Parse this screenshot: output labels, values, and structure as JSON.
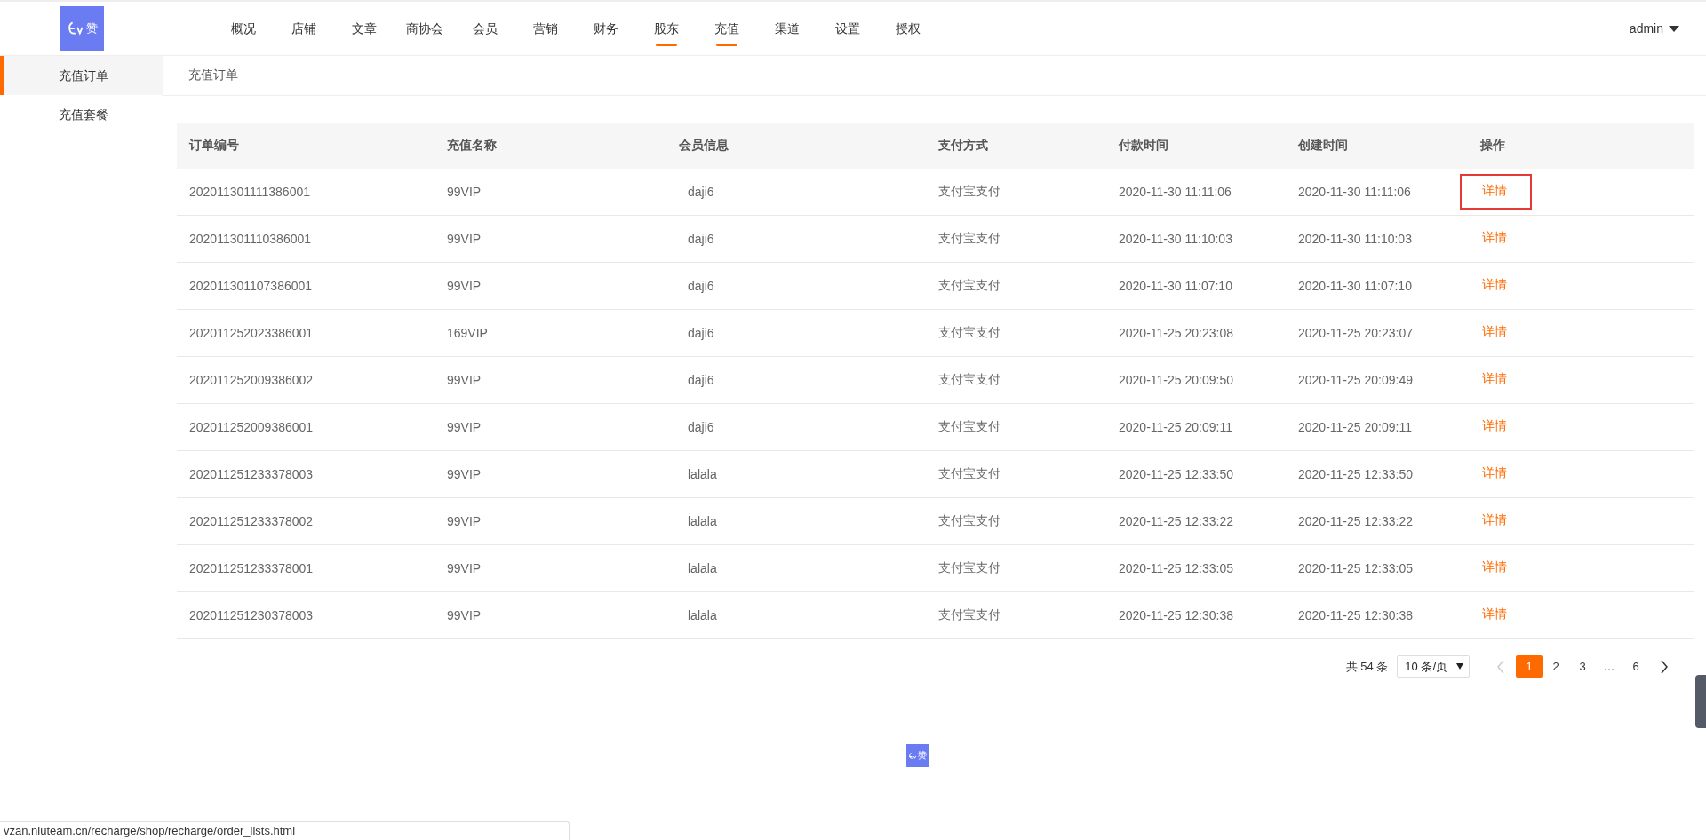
{
  "header": {
    "logo": {
      "text": "赞"
    },
    "nav": [
      {
        "label": "概况",
        "selected": false
      },
      {
        "label": "店铺",
        "selected": false
      },
      {
        "label": "文章",
        "selected": false
      },
      {
        "label": "商协会",
        "selected": false
      },
      {
        "label": "会员",
        "selected": false
      },
      {
        "label": "营销",
        "selected": false
      },
      {
        "label": "财务",
        "selected": false
      },
      {
        "label": "股东",
        "selected": true
      },
      {
        "label": "充值",
        "selected": true
      },
      {
        "label": "渠道",
        "selected": false
      },
      {
        "label": "设置",
        "selected": false
      },
      {
        "label": "授权",
        "selected": false
      }
    ],
    "user": "admin"
  },
  "sidebar": {
    "items": [
      {
        "label": "充值订单",
        "selected": true
      },
      {
        "label": "充值套餐",
        "selected": false
      }
    ]
  },
  "breadcrumb": "充值订单",
  "table": {
    "columns": [
      "订单编号",
      "充值名称",
      "会员信息",
      "支付方式",
      "付款时间",
      "创建时间",
      "操作"
    ],
    "rows": [
      {
        "cells": [
          "202011301111386001",
          "99VIP",
          "daji6",
          "支付宝支付",
          "2020-11-30 11:11:06",
          "2020-11-30 11:11:06"
        ],
        "action": "详情",
        "highlighted": true
      },
      {
        "cells": [
          "202011301110386001",
          "99VIP",
          "daji6",
          "支付宝支付",
          "2020-11-30 11:10:03",
          "2020-11-30 11:10:03"
        ],
        "action": "详情",
        "highlighted": false
      },
      {
        "cells": [
          "202011301107386001",
          "99VIP",
          "daji6",
          "支付宝支付",
          "2020-11-30 11:07:10",
          "2020-11-30 11:07:10"
        ],
        "action": "详情",
        "highlighted": false
      },
      {
        "cells": [
          "202011252023386001",
          "169VIP",
          "daji6",
          "支付宝支付",
          "2020-11-25 20:23:08",
          "2020-11-25 20:23:07"
        ],
        "action": "详情",
        "highlighted": false
      },
      {
        "cells": [
          "202011252009386002",
          "99VIP",
          "daji6",
          "支付宝支付",
          "2020-11-25 20:09:50",
          "2020-11-25 20:09:49"
        ],
        "action": "详情",
        "highlighted": false
      },
      {
        "cells": [
          "202011252009386001",
          "99VIP",
          "daji6",
          "支付宝支付",
          "2020-11-25 20:09:11",
          "2020-11-25 20:09:11"
        ],
        "action": "详情",
        "highlighted": false
      },
      {
        "cells": [
          "202011251233378003",
          "99VIP",
          "lalala",
          "支付宝支付",
          "2020-11-25 12:33:50",
          "2020-11-25 12:33:50"
        ],
        "action": "详情",
        "highlighted": false
      },
      {
        "cells": [
          "202011251233378002",
          "99VIP",
          "lalala",
          "支付宝支付",
          "2020-11-25 12:33:22",
          "2020-11-25 12:33:22"
        ],
        "action": "详情",
        "highlighted": false
      },
      {
        "cells": [
          "202011251233378001",
          "99VIP",
          "lalala",
          "支付宝支付",
          "2020-11-25 12:33:05",
          "2020-11-25 12:33:05"
        ],
        "action": "详情",
        "highlighted": false
      },
      {
        "cells": [
          "202011251230378003",
          "99VIP",
          "lalala",
          "支付宝支付",
          "2020-11-25 12:30:38",
          "2020-11-25 12:30:38"
        ],
        "action": "详情",
        "highlighted": false
      }
    ]
  },
  "pagination": {
    "total": "共 54 条",
    "page_size": "10 条/页",
    "pages": [
      {
        "label": "1",
        "selected": true
      },
      {
        "label": "2",
        "selected": false
      },
      {
        "label": "3",
        "selected": false
      },
      {
        "label": "…",
        "selected": false
      },
      {
        "label": "6",
        "selected": false
      }
    ]
  },
  "footer_logo": {
    "text": "赞"
  },
  "status_bar": "vzan.niuteam.cn/recharge/shop/recharge/order_lists.html"
}
